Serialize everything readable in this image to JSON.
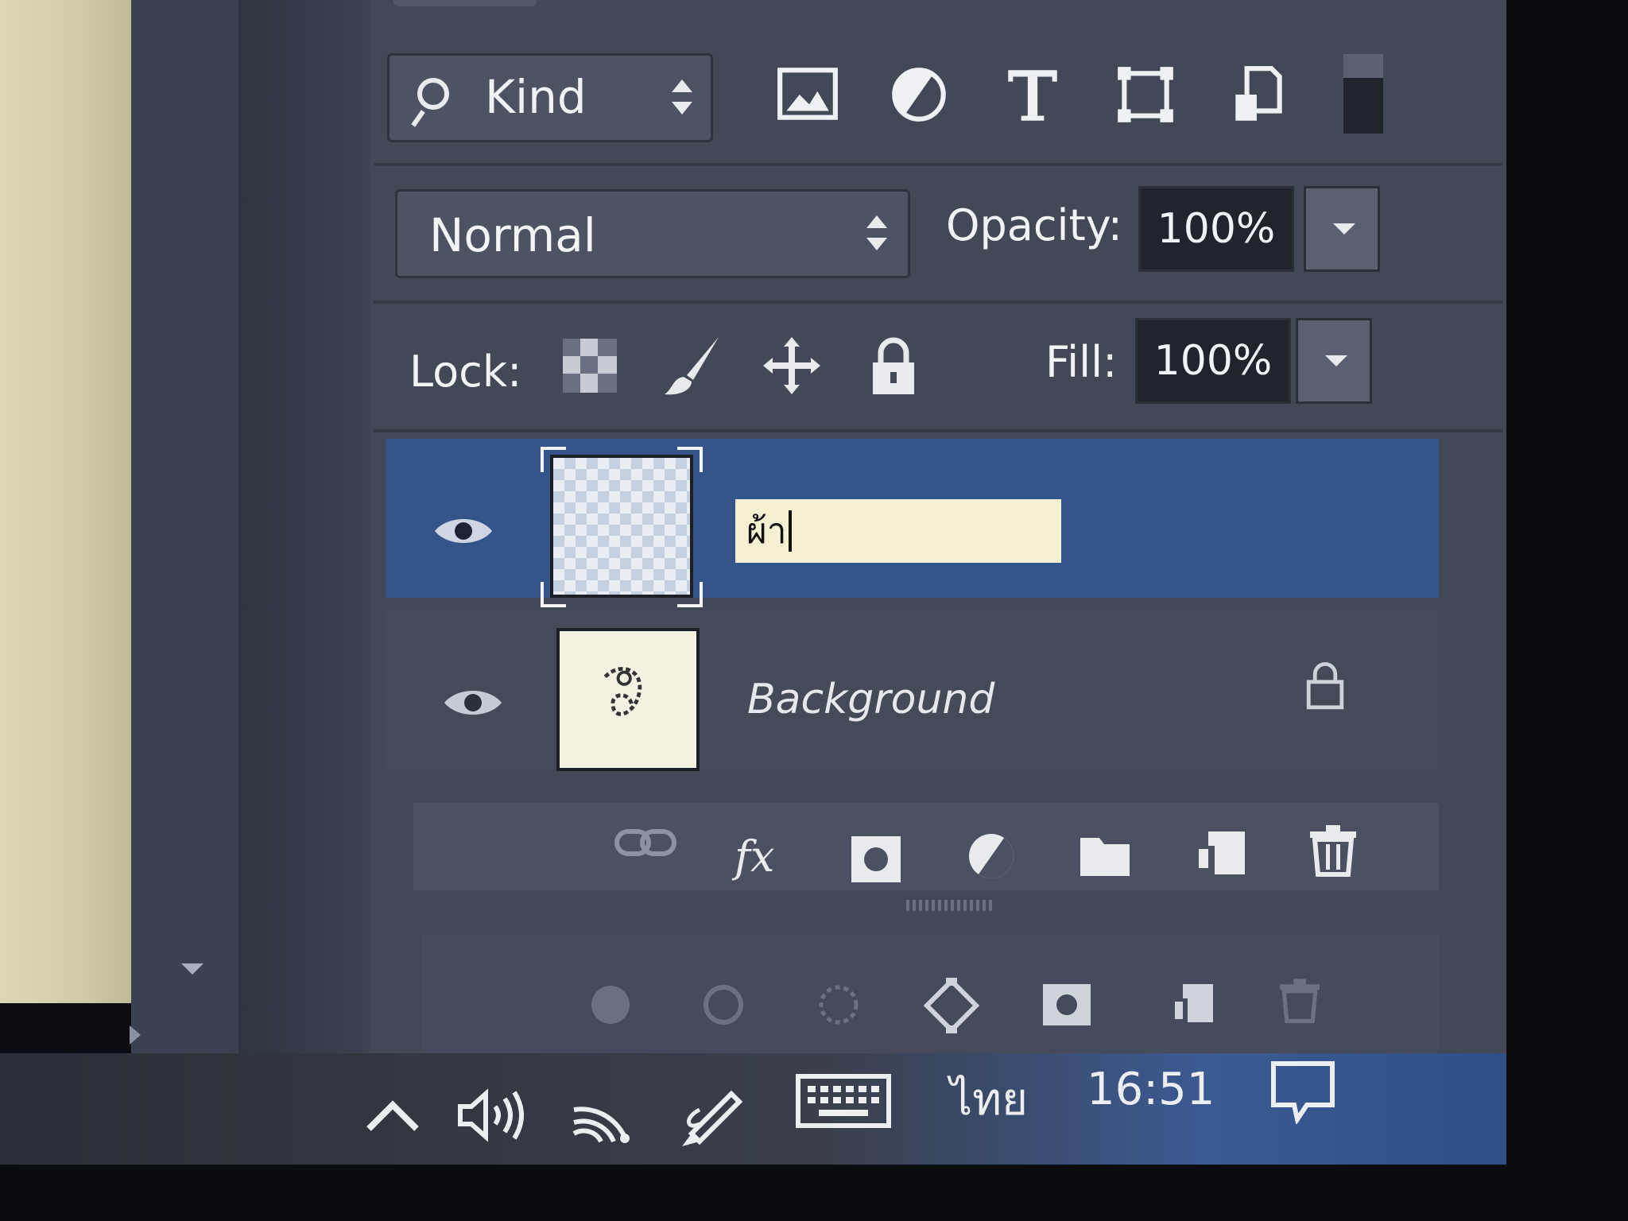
{
  "filter": {
    "kind_label": "Kind",
    "icons": [
      "image-filter-icon",
      "adjustment-filter-icon",
      "type-filter-icon",
      "shape-filter-icon",
      "smart-object-filter-icon"
    ]
  },
  "blend": {
    "mode": "Normal",
    "opacity_label": "Opacity:",
    "opacity_value": "100%"
  },
  "lock": {
    "label": "Lock:",
    "fill_label": "Fill:",
    "fill_value": "100%"
  },
  "layers": [
    {
      "name_editing": "ผ้า",
      "selected": true,
      "thumbnail": "transparent"
    },
    {
      "name": "Background",
      "selected": false,
      "locked": true,
      "thumbnail": "artwork"
    }
  ],
  "taskbar": {
    "language": "ไทย",
    "time": "16:51"
  },
  "colors": {
    "panel_bg": "#424856",
    "selected_row": "#35558a",
    "input_bg": "#f3f1d2"
  }
}
